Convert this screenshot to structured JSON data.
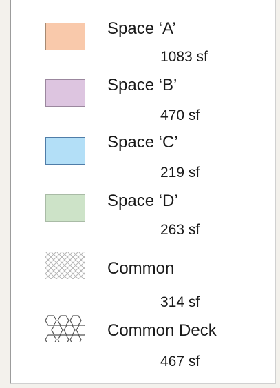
{
  "legend": {
    "items": [
      {
        "name": "Space ‘A’",
        "area": "1083 sf",
        "fill": "#f9c9ab",
        "stroke": "#a78a72",
        "pattern": "solid"
      },
      {
        "name": "Space ‘B’",
        "area": "470 sf",
        "fill": "#ddc5e0",
        "stroke": "#9b879e",
        "pattern": "solid"
      },
      {
        "name": "Space ‘C’",
        "area": "219 sf",
        "fill": "#b3dff7",
        "stroke": "#4f7da8",
        "pattern": "solid"
      },
      {
        "name": "Space ‘D’",
        "area": "263 sf",
        "fill": "#cde3c8",
        "stroke": "#a9bba6",
        "pattern": "solid"
      },
      {
        "name": "Common",
        "area": "314 sf",
        "fill": "#ffffff",
        "stroke": "#b5b5b5",
        "pattern": "crosshatch"
      },
      {
        "name": "Common Deck",
        "area": "467 sf",
        "fill": "#ffffff",
        "stroke": "#555555",
        "pattern": "hexagon"
      }
    ]
  }
}
